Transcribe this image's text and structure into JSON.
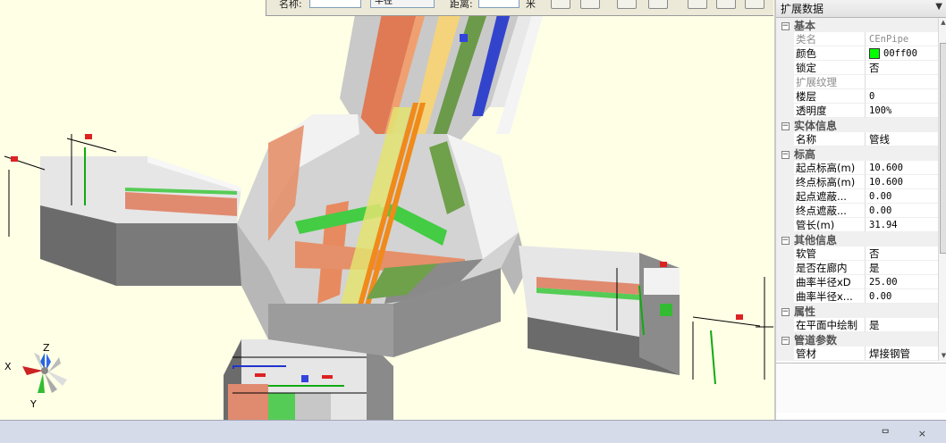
{
  "toolbar": {
    "label1": "名称:",
    "field1": "",
    "field2": "半径",
    "label2": "距离:",
    "label3": "米"
  },
  "viewport": {
    "axis_labels": {
      "x": "X",
      "y": "Y",
      "z": "Z"
    }
  },
  "panel": {
    "title": "扩展数据",
    "categories": [
      {
        "label": "基本",
        "rows": [
          {
            "name": "类名",
            "value": "CEnPipe",
            "disabled": true
          },
          {
            "name": "颜色",
            "value": "00ff00",
            "color": "#00ff00"
          },
          {
            "name": "锁定",
            "value": "否"
          },
          {
            "name": "扩展纹理",
            "value": "",
            "disabled": true
          },
          {
            "name": "楼层",
            "value": "0"
          },
          {
            "name": "透明度",
            "value": "100%"
          }
        ]
      },
      {
        "label": "实体信息",
        "rows": [
          {
            "name": "名称",
            "value": "管线"
          }
        ]
      },
      {
        "label": "标高",
        "rows": [
          {
            "name": "起点标高(m)",
            "value": "10.600"
          },
          {
            "name": "终点标高(m)",
            "value": "10.600"
          },
          {
            "name": "起点遮蔽...",
            "value": "0.00"
          },
          {
            "name": "终点遮蔽...",
            "value": "0.00"
          },
          {
            "name": "管长(m)",
            "value": "31.94"
          }
        ]
      },
      {
        "label": "其他信息",
        "rows": [
          {
            "name": "软管",
            "value": "否"
          },
          {
            "name": "是否在廊内",
            "value": "是"
          },
          {
            "name": "曲率半径xD",
            "value": "25.00"
          },
          {
            "name": "曲率半径x...",
            "value": "0.00"
          }
        ]
      },
      {
        "label": "属性",
        "rows": [
          {
            "name": "在平面中绘制",
            "value": "是"
          }
        ]
      },
      {
        "label": "管道参数",
        "rows": [
          {
            "name": "管材",
            "value": "焊接钢管"
          }
        ]
      }
    ]
  },
  "bottom": {
    "pins": "ᄆ ×"
  }
}
